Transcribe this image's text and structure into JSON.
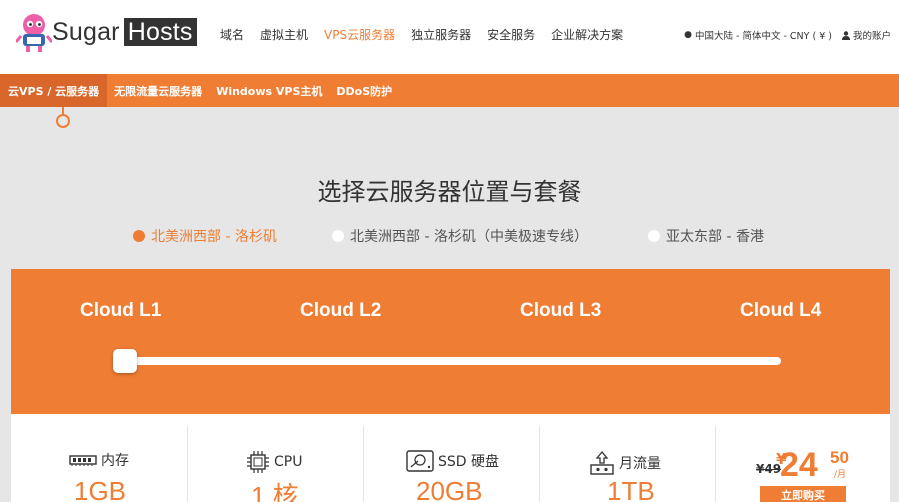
{
  "brand": {
    "sugar": "Sugar",
    "hosts": "Hosts"
  },
  "main_nav": [
    {
      "label": "域名",
      "active": false
    },
    {
      "label": "虚拟主机",
      "active": false
    },
    {
      "label": "VPS云服务器",
      "active": true
    },
    {
      "label": "独立服务器",
      "active": false
    },
    {
      "label": "安全服务",
      "active": false
    },
    {
      "label": "企业解决方案",
      "active": false
    }
  ],
  "utility": {
    "locale": "中国大陆 - 简体中文 - CNY ( ¥ )",
    "account": "我的账户"
  },
  "sub_nav": [
    {
      "label": "云VPS / 云服务器",
      "active": true
    },
    {
      "label": "无限流量云服务器",
      "active": false
    },
    {
      "label": "Windows VPS主机",
      "active": false
    },
    {
      "label": "DDoS防护",
      "active": false
    }
  ],
  "heading": "选择云服务器位置与套餐",
  "regions": [
    {
      "label": "北美洲西部 - 洛杉矶",
      "selected": true
    },
    {
      "label": "北美洲西部 - 洛杉矶（中美极速专线）",
      "selected": false
    },
    {
      "label": "亚太东部 - 香港",
      "selected": false
    }
  ],
  "plans": [
    {
      "label": "Cloud L1"
    },
    {
      "label": "Cloud L2"
    },
    {
      "label": "Cloud L3"
    },
    {
      "label": "Cloud L4"
    }
  ],
  "slider": {
    "selected_index": 0,
    "steps": 4
  },
  "specs": [
    {
      "label": "内存",
      "value": "1GB",
      "icon": "memory-icon"
    },
    {
      "label": "CPU",
      "value": "1 核",
      "icon": "cpu-icon"
    },
    {
      "label": "SSD 硬盘",
      "value": "20GB",
      "icon": "ssd-icon"
    },
    {
      "label": "月流量",
      "value": "1TB",
      "icon": "traffic-icon"
    }
  ],
  "price": {
    "old": "¥49",
    "currency": "¥",
    "integer": "24",
    "decimal": "50",
    "period": "/月",
    "buy_label": "立即购买"
  },
  "colors": {
    "accent": "#ef7d34",
    "accent_dark": "#d9662a",
    "background": "#e6e6e6"
  }
}
